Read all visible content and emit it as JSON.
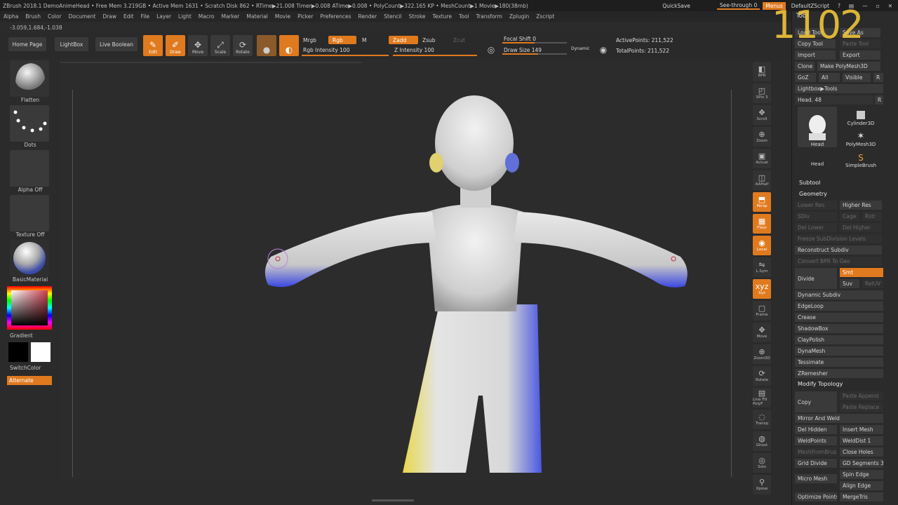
{
  "titlebar": {
    "text": "ZBrush 2018.1   DemoAnimeHead   • Free Mem 3.219GB • Active Mem 1631 • Scratch Disk 862 • RTime▶21.008 Timer▶0.008 ATime▶0.008 • PolyCount▶322.165 KP • MeshCount▶1  Movie▶180(38mb)",
    "quicksave": "QuickSave",
    "seethrough": "See-through  0",
    "menus": "Menus",
    "script": "DefaultZScript"
  },
  "menubar": [
    "Alpha",
    "Brush",
    "Color",
    "Document",
    "Draw",
    "Edit",
    "File",
    "Layer",
    "Light",
    "Macro",
    "Marker",
    "Material",
    "Movie",
    "Picker",
    "Preferences",
    "Render",
    "Stencil",
    "Stroke",
    "Texture",
    "Tool",
    "Transform",
    "Zplugin",
    "Zscript"
  ],
  "coords": "-3.059,1.684,-1.038",
  "shelf": {
    "home": "Home Page",
    "lightbox": "LightBox",
    "liveboolean": "Live Boolean",
    "edit": "Edit",
    "draw": "Draw",
    "move": "Move",
    "scale": "Scale",
    "rotate": "Rotate",
    "mrgb": "Mrgb",
    "rgb": "Rgb",
    "m": "M",
    "rgb_intensity": "Rgb Intensity 100",
    "zadd": "Zadd",
    "zsub": "Zsub",
    "zcut": "Zcut",
    "z_intensity": "Z Intensity 100",
    "focal_shift": "Focal Shift 0",
    "draw_size": "Draw Size 149",
    "dynamic": "Dynamic",
    "active_points": "ActivePoints: 211,522",
    "total_points": "TotalPoints: 211,522"
  },
  "left": {
    "brush": "Flatten",
    "stroke": "Dots",
    "alpha": "Alpha Off",
    "texture": "Texture Off",
    "material": "BasicMaterial",
    "gradient": "Gradient",
    "switchcolor": "SwitchColor",
    "alternate": "Alternate"
  },
  "rightshelf": [
    {
      "label": "BPR",
      "icon": "bpr-icon"
    },
    {
      "label": "SPix 3",
      "icon": "spix-icon"
    },
    {
      "label": "Scroll",
      "icon": "scroll-icon"
    },
    {
      "label": "Zoom",
      "icon": "zoom-icon"
    },
    {
      "label": "Actual",
      "icon": "actual-icon"
    },
    {
      "label": "AAHalf",
      "icon": "aahalf-icon"
    },
    {
      "label": "Persp",
      "icon": "persp-icon"
    },
    {
      "label": "Floor",
      "icon": "floor-icon"
    },
    {
      "label": "Local",
      "icon": "local-icon"
    },
    {
      "label": "L.Sym",
      "icon": "lsym-icon"
    },
    {
      "label": "Xyz",
      "icon": "xyz-icon"
    },
    {
      "label": "Frame",
      "icon": "frame-icon"
    },
    {
      "label": "Move",
      "icon": "move-icon"
    },
    {
      "label": "Zoom3D",
      "icon": "zoom3d-icon"
    },
    {
      "label": "Rotate",
      "icon": "rotate-icon"
    },
    {
      "label": "Line Fill PolyF",
      "icon": "polyf-icon"
    },
    {
      "label": "Transp",
      "icon": "transp-icon"
    },
    {
      "label": "Ghost",
      "icon": "ghost-icon"
    },
    {
      "label": "Solo",
      "icon": "solo-icon"
    },
    {
      "label": "Xpose",
      "icon": "xpose-icon"
    }
  ],
  "tray": {
    "title": "Tool",
    "overlay_number": "1102",
    "load_tool": "Load Tool",
    "save_as": "Save As",
    "copy_tool": "Copy Tool",
    "paste_tool": "Paste Tool",
    "import": "Import",
    "export": "Export",
    "clone": "Clone",
    "make_polymesh": "Make PolyMesh3D",
    "goz": "GoZ",
    "all": "All",
    "visible": "Visible",
    "r": "R",
    "lightbox_tools": "Lightbox▶Tools",
    "head_slider": "Head. 48",
    "thumbs": [
      "Head",
      "Cylinder3D",
      "Head",
      "PolyMesh3D",
      "SimpleBrush"
    ],
    "subtool": "Subtool",
    "geometry": "Geometry",
    "lower_res": "Lower Res",
    "higher_res": "Higher Res",
    "sdiv": "SDiv",
    "cage": "Cage",
    "rstr": "Rstr",
    "del_lower": "Del Lower",
    "del_higher": "Del Higher",
    "freeze_subdiv": "Freeze SubDivision Levels",
    "reconstruct_subdiv": "Reconstruct Subdiv",
    "convert_bpr": "Convert BPR To Geo",
    "divide": "Divide",
    "smt": "Smt",
    "suv": "Suv",
    "reluv": "RelUV",
    "dynamic_subdiv": "Dynamic Subdiv",
    "edgeloop": "EdgeLoop",
    "crease": "Crease",
    "shadowbox": "ShadowBox",
    "claypolish": "ClayPolish",
    "dynamesh": "DynaMesh",
    "tessimate": "Tessimate",
    "zremesher": "ZRemesher",
    "modify_topology": "Modify Topology",
    "copy": "Copy",
    "paste_append": "Paste Append",
    "paste_replace": "Paste Replace",
    "mirror_weld": "Mirror And Weld",
    "del_hidden": "Del Hidden",
    "insert_mesh": "Insert Mesh",
    "weldpoints": "WeldPoints",
    "welddist": "WeldDist 1",
    "meshfrombrush": "MeshFromBrush",
    "close_holes": "Close Holes",
    "grid_divide": "Grid Divide",
    "gd_segments": "GD Segments 3",
    "spin_edge": "Spin Edge",
    "micro_mesh": "Micro Mesh",
    "align_edge": "Align Edge",
    "optimize_points": "Optimize Points",
    "mergetris": "MergeTris"
  },
  "colors": {
    "accent": "#e07a1f",
    "panel": "#2b2b2b",
    "button": "#3a3a3a"
  }
}
